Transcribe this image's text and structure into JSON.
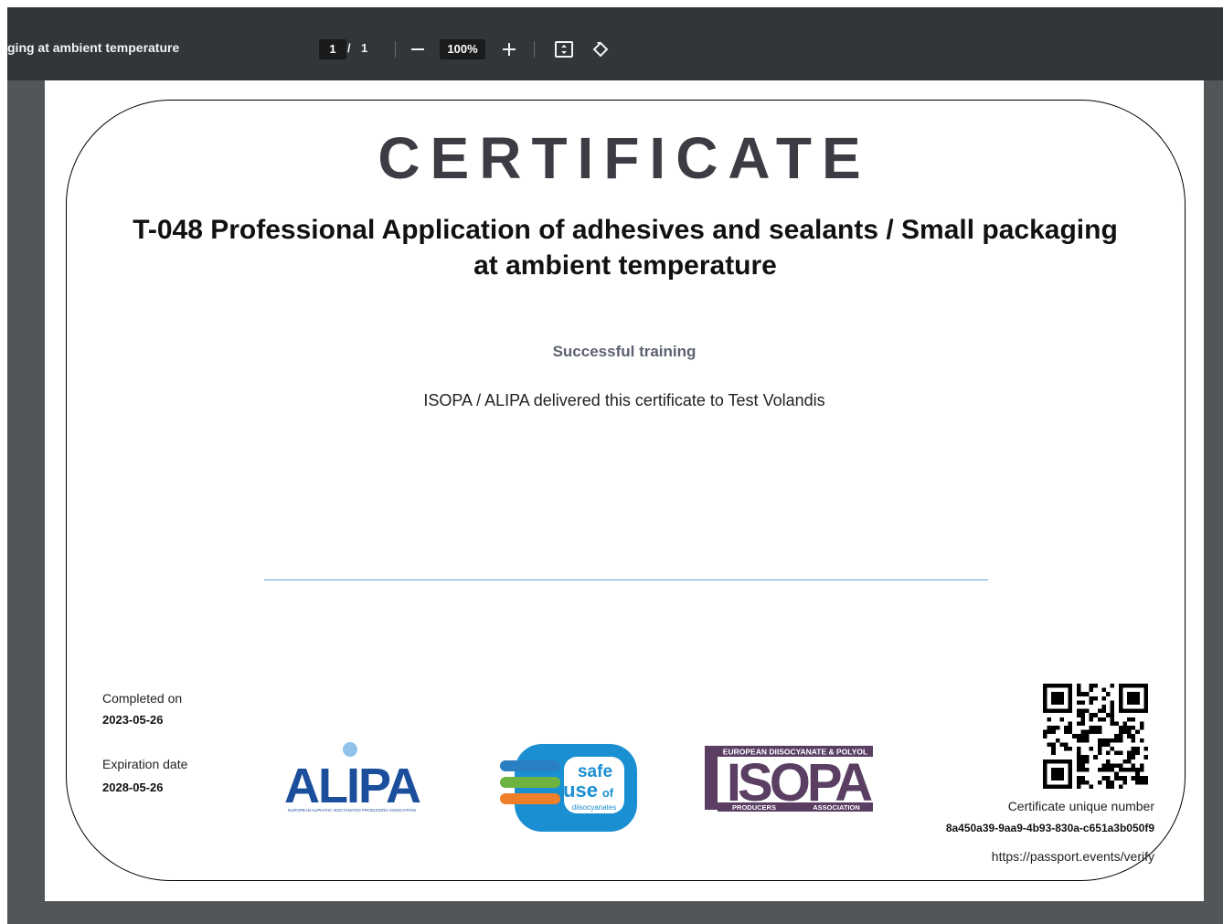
{
  "toolbar": {
    "title": "ging at ambient temperature",
    "page_current": "1",
    "page_separator": "/",
    "page_total": "1",
    "zoom": "100%",
    "icons": [
      "minus-icon",
      "plus-icon",
      "fit-page-icon",
      "rotate-icon"
    ]
  },
  "certificate": {
    "heading": "CERTIFICATE",
    "course_line1": "T-048 Professional Application of adhesives and sealants / Small packaging",
    "course_line2": "at ambient temperature",
    "status": "Successful training",
    "delivered_text": "ISOPA / ALIPA delivered this certificate to Test Volandis",
    "completed_label": "Completed on",
    "completed_value": "2023-05-26",
    "expiration_label": "Expiration date",
    "expiration_value": "2028-05-26",
    "unique_number_label": "Certificate unique number",
    "unique_number": "8a450a39-9aa9-4b93-830a-c651a3b050f9",
    "verify_url": "https://passport.events/verify",
    "logos": {
      "alipa": {
        "name": "ALIPA",
        "tagline": "EUROPEAN ALIPHATIC ISOCYANATES PRODUCERS ASSOCIATION"
      },
      "safe_use": {
        "line1": "safe",
        "line2": "use",
        "line3": "of",
        "line4": "diisocyanates"
      },
      "isopa": {
        "name": "ISOPA",
        "top": "EUROPEAN DIISOCYANATE & POLYOL",
        "left": "PRODUCERS",
        "right": "ASSOCIATION"
      }
    }
  },
  "colors": {
    "toolbar_bg": "#323639",
    "viewer_bg": "#525659",
    "alipa_blue": "#1b4f9c",
    "safe_blue": "#1a8fd1",
    "isopa_purple": "#5a3f63",
    "signature_line": "#5aa8de"
  }
}
